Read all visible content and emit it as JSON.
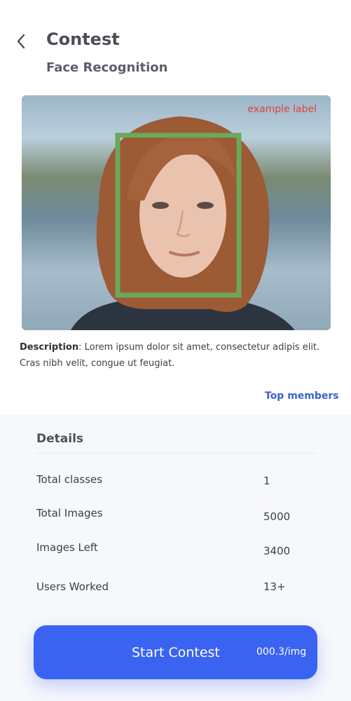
{
  "header": {
    "title": "Contest",
    "subtitle": "Face Recognition"
  },
  "image": {
    "label": "example label",
    "box_color": "#6aa85a"
  },
  "description": {
    "label": "Description",
    "text": ": Lorem ipsum dolor sit amet, consectetur adipis elit. Cras nibh velit, congue ut feugiat."
  },
  "top_members": "Top members",
  "details": {
    "heading": "Details",
    "rows": [
      {
        "label": "Total classes",
        "value": "1"
      },
      {
        "label": "Total Images",
        "value": "5000"
      },
      {
        "label": "Images Left",
        "value": "3400"
      },
      {
        "label": "Users Worked",
        "value": "13+"
      }
    ]
  },
  "action": {
    "label": "Start Contest",
    "price": "000.3/img"
  },
  "colors": {
    "accent": "#3b63f2",
    "link": "#3a62c9",
    "label_red": "#e04040"
  }
}
